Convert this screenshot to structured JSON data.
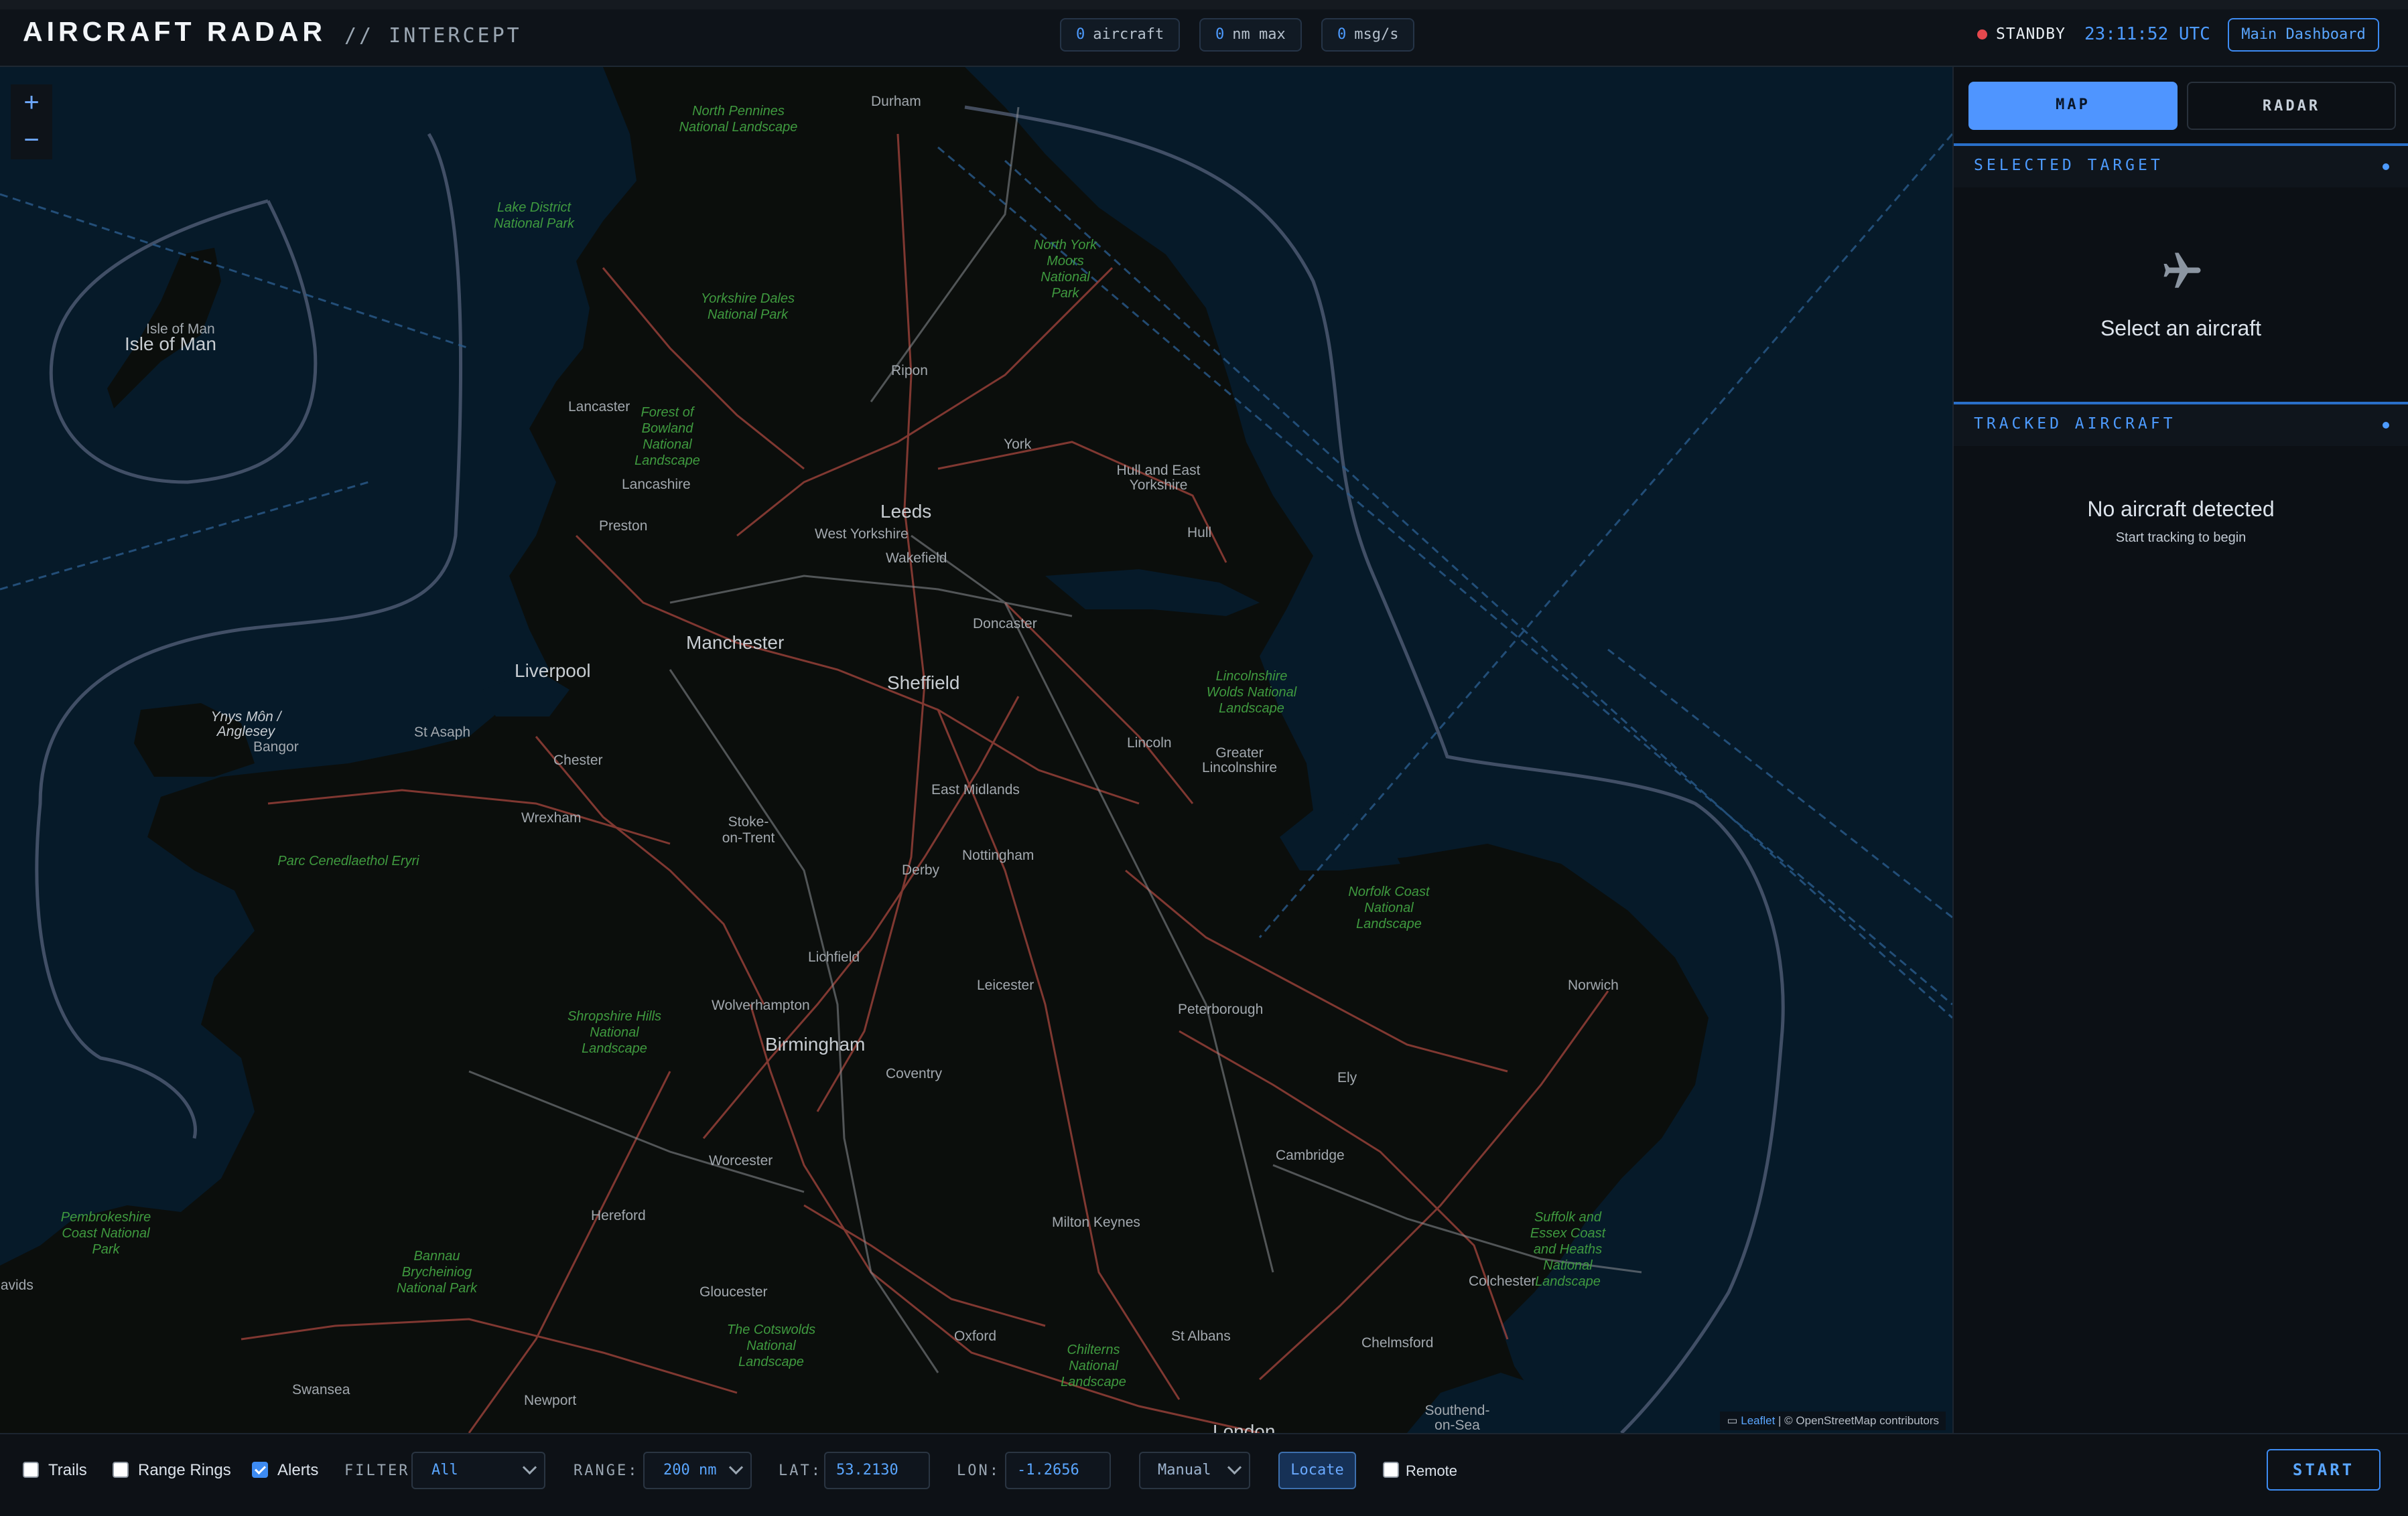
{
  "header": {
    "title": "AIRCRAFT RADAR",
    "subtitle": "// INTERCEPT",
    "stats": [
      {
        "value": "0",
        "label": "aircraft"
      },
      {
        "value": "0",
        "label": "nm max"
      },
      {
        "value": "0",
        "label": "msg/s"
      }
    ],
    "status": "STANDBY",
    "status_color": "#e5484d",
    "clock": "23:11:52 UTC",
    "dashboard_label": "Main Dashboard"
  },
  "map": {
    "zoom_in": "+",
    "zoom_out": "−",
    "attribution_link": "Leaflet",
    "attribution_text": "| © OpenStreetMap contributors",
    "places": {
      "durham": "Durham",
      "isle_of_man_small": "Isle of Man",
      "isle_of_man": "Isle of Man",
      "ripon": "Ripon",
      "lancaster": "Lancaster",
      "lancashire": "Lancashire",
      "york": "York",
      "hull_east_yorkshire": "Hull and East Yorkshire",
      "preston": "Preston",
      "leeds": "Leeds",
      "west_yorkshire": "West Yorkshire",
      "wakefield": "Wakefield",
      "hull": "Hull",
      "doncaster": "Doncaster",
      "manchester": "Manchester",
      "liverpool": "Liverpool",
      "sheffield": "Sheffield",
      "ynys_mon": "Ynys Môn / Anglesey",
      "bangor": "Bangor",
      "st_asaph": "St Asaph",
      "chester": "Chester",
      "lincoln": "Lincoln",
      "greater_lincolnshire": "Greater Lincolnshire",
      "wrexham": "Wrexham",
      "east_midlands": "East Midlands",
      "stoke": "Stoke-on-Trent",
      "nottingham": "Nottingham",
      "derby": "Derby",
      "lichfield": "Lichfield",
      "leicester": "Leicester",
      "wolverhampton": "Wolverhampton",
      "peterborough": "Peterborough",
      "norwich": "Norwich",
      "birmingham": "Birmingham",
      "coventry": "Coventry",
      "ely": "Ely",
      "cambridge": "Cambridge",
      "worcester": "Worcester",
      "hereford": "Hereford",
      "milton_keynes": "Milton Keynes",
      "colchester": "Colchester",
      "gloucester": "Gloucester",
      "oxford": "Oxford",
      "st_albans": "St Albans",
      "chelmsford": "Chelmsford",
      "swansea": "Swansea",
      "newport": "Newport",
      "southend": "Southend-on-Sea",
      "london": "London",
      "st_davids": "St Davids"
    },
    "parks": {
      "north_pennines": "North Pennines National Landscape",
      "lake_district": "Lake District National Park",
      "yorkshire_dales": "Yorkshire Dales National Park",
      "north_york_moors": "North York Moors National Park",
      "forest_of_bowland": "Forest of Bowland National Landscape",
      "lincolnshire_wolds": "Lincolnshire Wolds National Landscape",
      "parc_eryri": "Parc Cenedlaethol Eryri",
      "norfolk_coast": "Norfolk Coast National Landscape",
      "shropshire_hills": "Shropshire Hills National Landscape",
      "pembrokeshire": "Pembrokeshire Coast National Park",
      "bannau": "Bannau Brycheiniog National Park",
      "cotswolds": "The Cotswolds National Landscape",
      "chilterns": "Chilterns National Landscape",
      "suffolk": "Suffolk and Essex Coast and Heaths National Landscape"
    }
  },
  "panel": {
    "tabs": {
      "map": "MAP",
      "radar": "RADAR"
    },
    "selected_title": "SELECTED TARGET",
    "select_prompt": "Select an aircraft",
    "tracked_title": "TRACKED AIRCRAFT",
    "empty_title": "No aircraft detected",
    "empty_sub": "Start tracking to begin"
  },
  "controls": {
    "trails": {
      "label": "Trails",
      "checked": false
    },
    "range_rings": {
      "label": "Range Rings",
      "checked": false
    },
    "alerts": {
      "label": "Alerts",
      "checked": true
    },
    "filter_label": "FILTER:",
    "filter_value": "All",
    "range_label": "RANGE:",
    "range_value": "200 nm",
    "lat_label": "LAT:",
    "lat_value": "53.2130",
    "lon_label": "LON:",
    "lon_value": "-1.2656",
    "mode_value": "Manual",
    "locate_label": "Locate",
    "remote": {
      "label": "Remote",
      "checked": false
    },
    "start_label": "START"
  },
  "colors": {
    "accent": "#4d9bff",
    "sea": "#061a29",
    "land": "#0b0e0c"
  }
}
